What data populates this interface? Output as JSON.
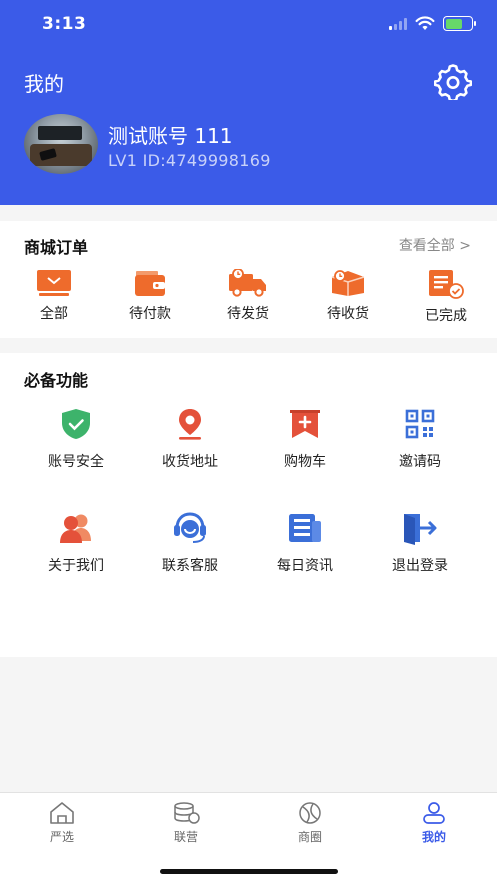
{
  "status_bar": {
    "time": "3:13"
  },
  "header": {
    "title": "我的",
    "username": "测试账号 111",
    "user_id": "LV1  ID:4749998169"
  },
  "orders": {
    "title": "商城订单",
    "view_all": "查看全部 >",
    "items": [
      {
        "label": "全部",
        "icon": "monitor-icon"
      },
      {
        "label": "待付款",
        "icon": "wallet-icon"
      },
      {
        "label": "待发货",
        "icon": "delivery-truck-icon"
      },
      {
        "label": "待收货",
        "icon": "package-box-icon"
      },
      {
        "label": "已完成",
        "icon": "completed-document-icon"
      }
    ]
  },
  "functions": {
    "title": "必备功能",
    "items": [
      {
        "label": "账号安全",
        "icon": "shield-check-icon"
      },
      {
        "label": "收货地址",
        "icon": "location-pin-icon"
      },
      {
        "label": "购物车",
        "icon": "cart-bookmark-icon"
      },
      {
        "label": "邀请码",
        "icon": "qr-code-icon"
      },
      {
        "label": "关于我们",
        "icon": "people-icon"
      },
      {
        "label": "联系客服",
        "icon": "headset-support-icon"
      },
      {
        "label": "每日资讯",
        "icon": "news-icon"
      },
      {
        "label": "退出登录",
        "icon": "logout-icon"
      }
    ]
  },
  "tabbar": {
    "items": [
      {
        "label": "严选",
        "icon": "home-icon"
      },
      {
        "label": "联营",
        "icon": "coins-stack-icon"
      },
      {
        "label": "商圈",
        "icon": "circle-lens-icon"
      },
      {
        "label": "我的",
        "icon": "user-icon"
      }
    ],
    "active_index": 3
  },
  "colors": {
    "primary": "#3b5be8",
    "orange": "#ee6b2c",
    "green": "#3db36b",
    "red": "#e4513a",
    "blue": "#3b6fd8"
  }
}
